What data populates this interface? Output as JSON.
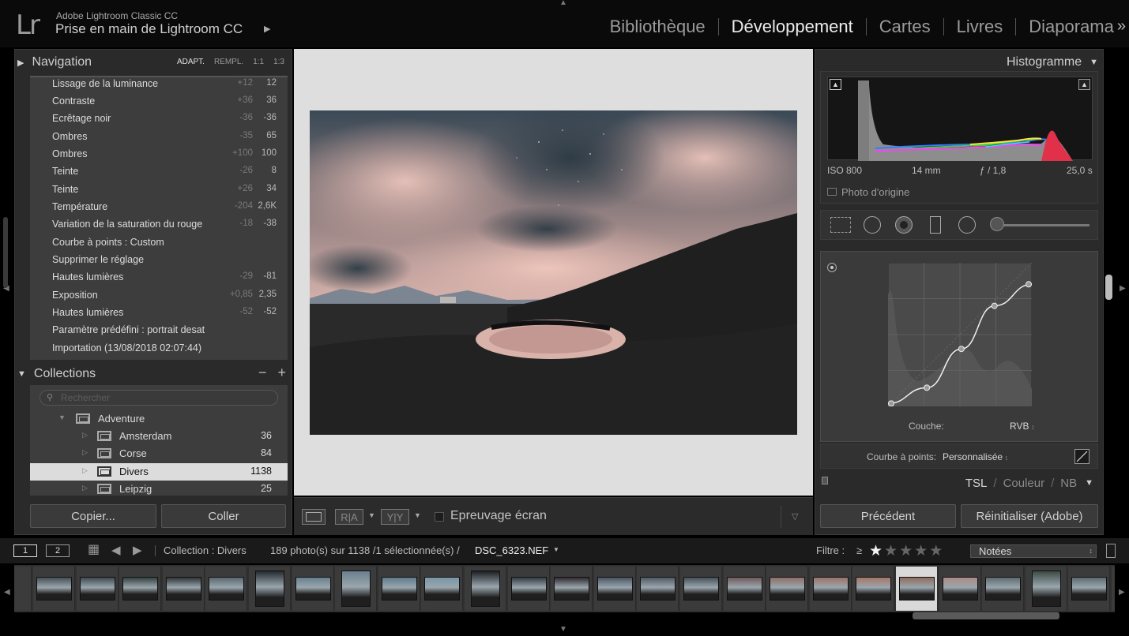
{
  "header": {
    "app_name": "Adobe Lightroom Classic CC",
    "catalog_title": "Prise en main de Lightroom CC",
    "modules": [
      "Bibliothèque",
      "Développement",
      "Cartes",
      "Livres",
      "Diaporama"
    ],
    "active_module": "Développement",
    "more_glyph": "»"
  },
  "navigator": {
    "title": "Navigation",
    "zoom_options": [
      "ADAPT.",
      "REMPL.",
      "1:1",
      "1:3"
    ]
  },
  "history": [
    {
      "name": "Lissage de la luminance",
      "delta": "+12",
      "value": "12"
    },
    {
      "name": "Contraste",
      "delta": "+36",
      "value": "36"
    },
    {
      "name": "Ecrêtage noir",
      "delta": "-36",
      "value": "-36"
    },
    {
      "name": "Ombres",
      "delta": "-35",
      "value": "65"
    },
    {
      "name": "Ombres",
      "delta": "+100",
      "value": "100"
    },
    {
      "name": "Teinte",
      "delta": "-26",
      "value": "8"
    },
    {
      "name": "Teinte",
      "delta": "+26",
      "value": "34"
    },
    {
      "name": "Température",
      "delta": "-204",
      "value": "2,6K"
    },
    {
      "name": "Variation de la saturation du rouge",
      "delta": "-18",
      "value": "-38"
    },
    {
      "name": "Courbe à points : Custom",
      "delta": "",
      "value": ""
    },
    {
      "name": "Supprimer le réglage",
      "delta": "",
      "value": ""
    },
    {
      "name": "Hautes lumières",
      "delta": "-29",
      "value": "-81"
    },
    {
      "name": "Exposition",
      "delta": "+0,85",
      "value": "2,35"
    },
    {
      "name": "Hautes lumières",
      "delta": "-52",
      "value": "-52"
    },
    {
      "name": "Paramètre prédéfini : portrait desat",
      "delta": "",
      "value": ""
    },
    {
      "name": "Importation (13/08/2018 02:07:44)",
      "delta": "",
      "value": ""
    }
  ],
  "collections": {
    "title": "Collections",
    "search_placeholder": "Rechercher",
    "parent": "Adventure",
    "items": [
      {
        "name": "Amsterdam",
        "count": "36",
        "selected": false
      },
      {
        "name": "Corse",
        "count": "84",
        "selected": false
      },
      {
        "name": "Divers",
        "count": "1138",
        "selected": true
      },
      {
        "name": "Leipzig",
        "count": "25",
        "selected": false
      }
    ]
  },
  "left_buttons": {
    "copy": "Copier...",
    "paste": "Coller"
  },
  "toolbar": {
    "proof_label": "Epreuvage écran",
    "before_after": "R|A",
    "ya": "Y|Y"
  },
  "histogram": {
    "title": "Histogramme",
    "iso": "ISO 800",
    "focal": "14 mm",
    "aperture": "ƒ / 1,8",
    "shutter": "25,0 s",
    "original_label": "Photo d'origine"
  },
  "tone_curve": {
    "channel_label": "Couche:",
    "channel_value": "RVB",
    "point_curve_label": "Courbe à points:",
    "point_curve_value": "Personnalisée",
    "points": [
      [
        0,
        0.02
      ],
      [
        0.27,
        0.13
      ],
      [
        0.51,
        0.4
      ],
      [
        0.74,
        0.7
      ],
      [
        1,
        0.85
      ]
    ]
  },
  "hsl_tabs": [
    "TSL",
    "Couleur",
    "NB"
  ],
  "right_buttons": {
    "previous": "Précédent",
    "reset": "Réinitialiser (Adobe)"
  },
  "filmstrip_bar": {
    "monitor_1": "1",
    "monitor_2": "2",
    "source": "Collection : Divers",
    "count_text": "189 photo(s) sur 1138 /1 sélectionnée(s) /",
    "filename": "DSC_6323.NEF",
    "filter_label": "Filtre :",
    "filter_op": "≥",
    "rating_min": 1,
    "rated_option": "Notées"
  },
  "filmstrip": {
    "thumb_colors": [
      "#445055",
      "#3e4a50",
      "#35403f",
      "#2f3538",
      "#5a6770",
      "#242a30",
      "#67808e",
      "#6a7f8d",
      "#607b8e",
      "#7a96a8",
      "#1c1f23",
      "#343b44",
      "#2f2a30",
      "#4a5563",
      "#505a66",
      "#47505b",
      "#6f5b5c",
      "#8d6e69",
      "#9c7369",
      "#a57666",
      "#8f6a5c",
      "#ac8a84",
      "#5d6b70",
      "#3b4a45",
      "#5c6a6e",
      "#4a4644"
    ],
    "portrait_indices": [
      5,
      7,
      10,
      23
    ],
    "selected_index": 20
  }
}
